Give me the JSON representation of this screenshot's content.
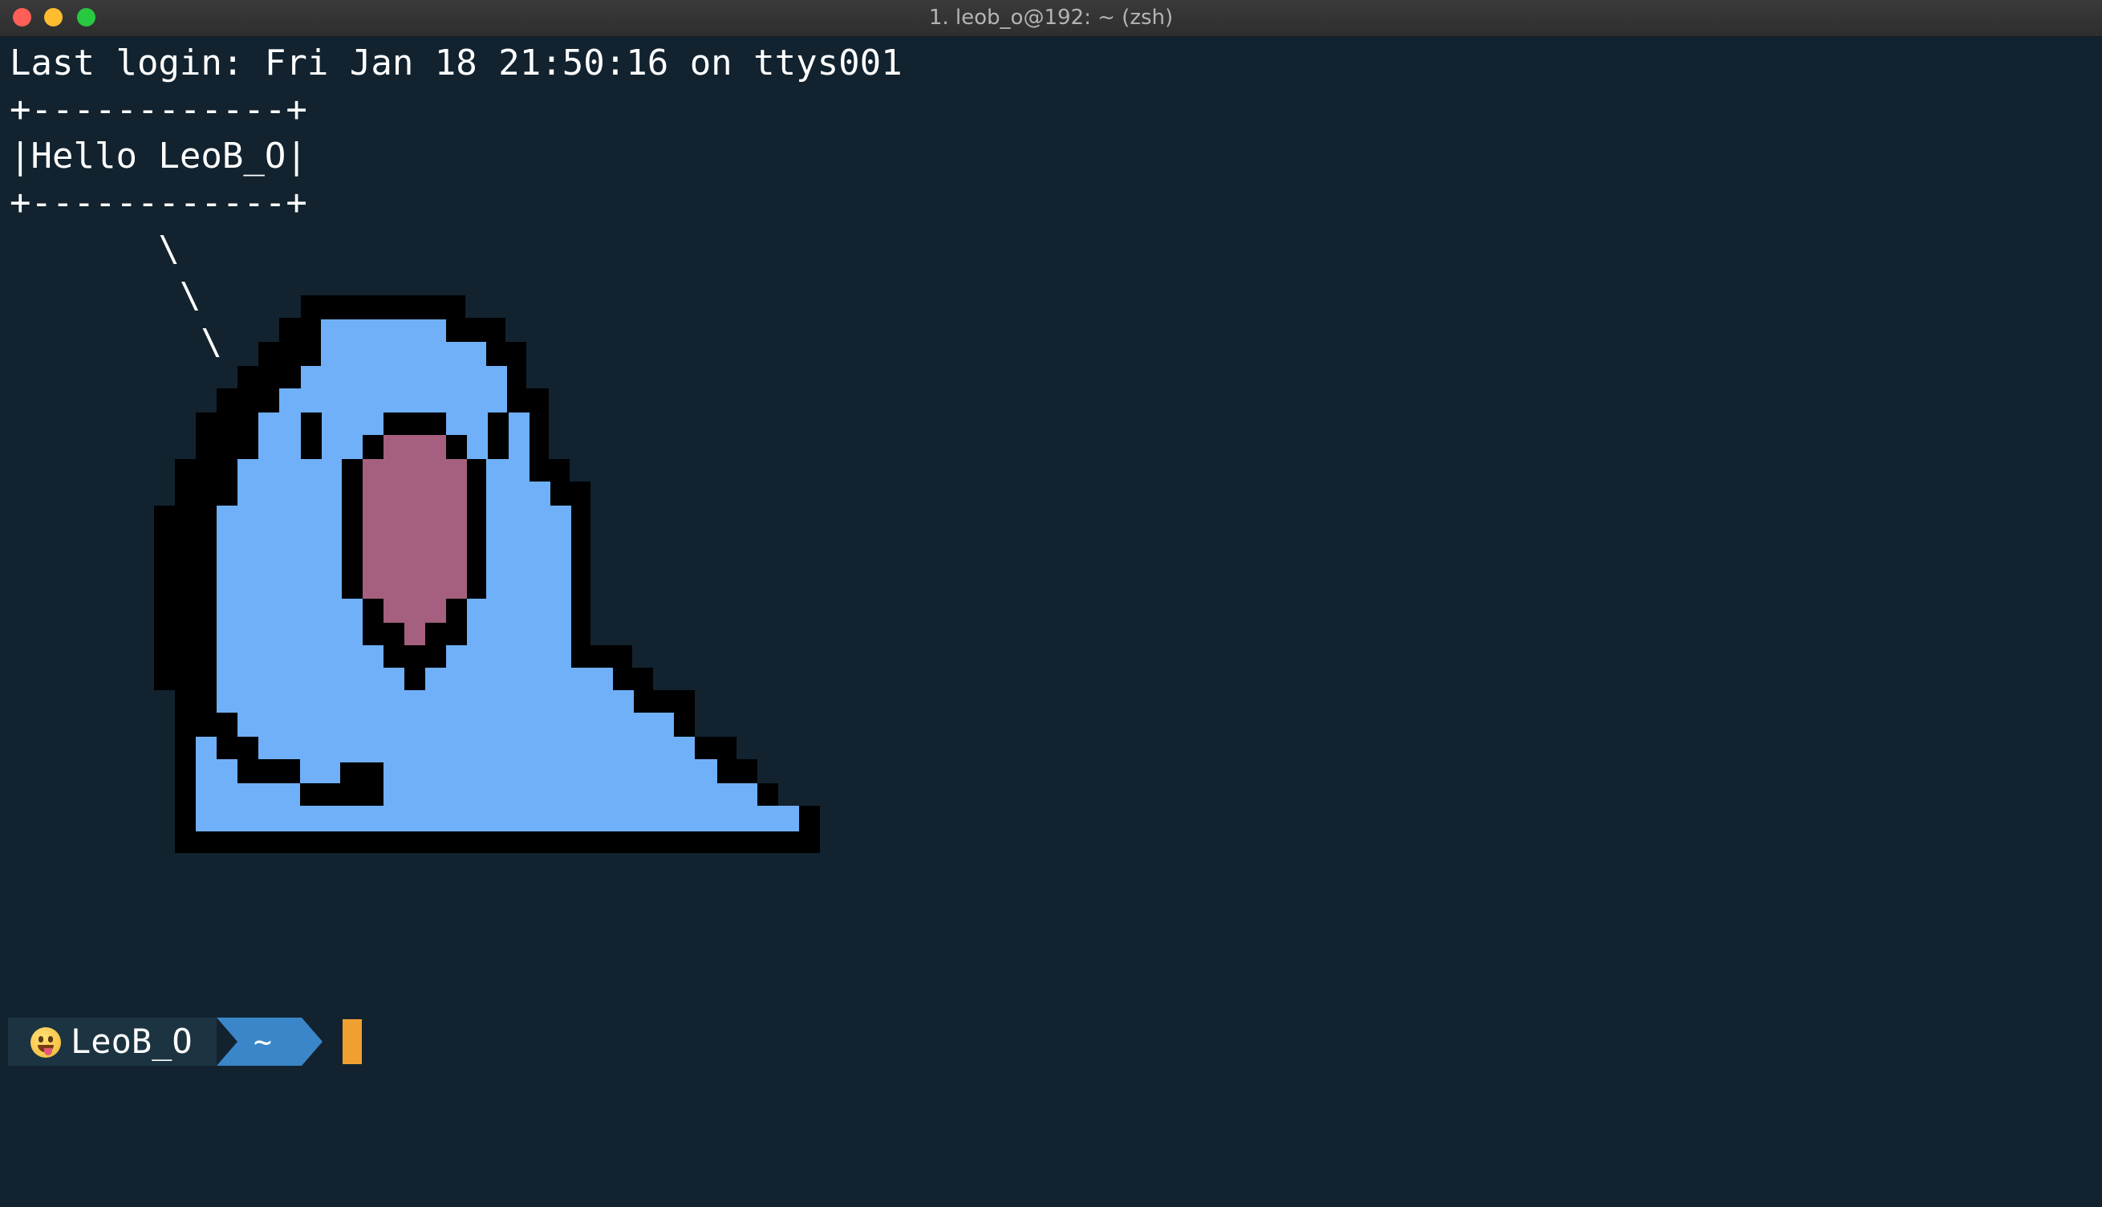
{
  "window": {
    "title": "1. leob_o@192: ~ (zsh)"
  },
  "terminal": {
    "lines": [
      "Last login: Fri Jan 18 21:50:16 on ttys001",
      "+------------+",
      "|Hello LeoB_O|",
      "+------------+",
      "       \\",
      "        \\",
      "         \\"
    ],
    "background": "#12232f",
    "text_color": "#ffffff"
  },
  "art": {
    "body_color": "#6fb0f8",
    "mouth_color": "#a4607e",
    "outline_color": "#000000"
  },
  "prompt": {
    "emoji_icon": "face-with-tongue-icon",
    "user": "LeoB_O",
    "directory": "~",
    "user_segment_color": "#1c3441",
    "dir_segment_color": "#3a86c8",
    "cursor_color": "#f0a030"
  }
}
